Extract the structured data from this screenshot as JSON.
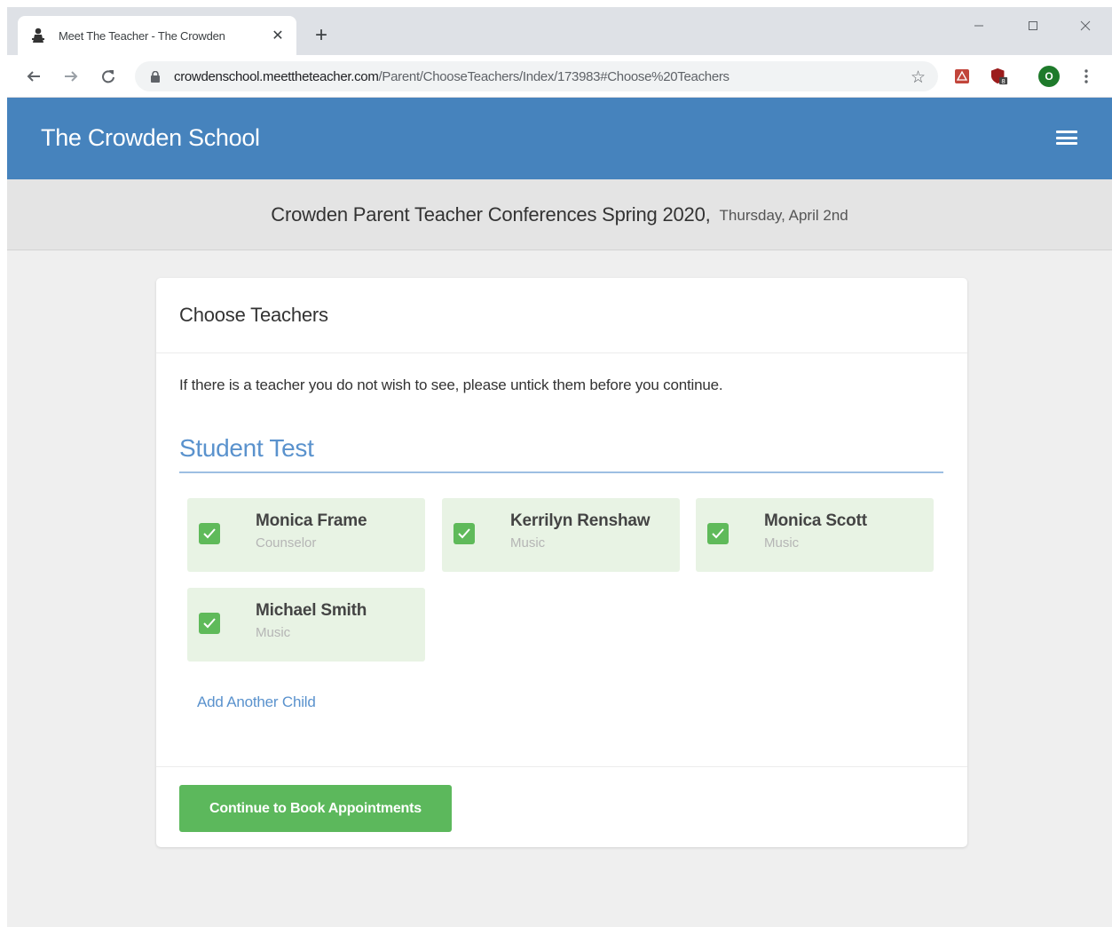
{
  "browser": {
    "tab_title": "Meet The Teacher - The Crowden",
    "tab_close": "✕",
    "new_tab": "+",
    "url_host": "crowdenschool.meettheteacher.com",
    "url_path": "/Parent/ChooseTeachers/Index/173983#Choose%20Teachers",
    "profile_initial": "O"
  },
  "header": {
    "brand": "The Crowden School",
    "menu_icon": "hamburger-menu-icon"
  },
  "event": {
    "name": "Crowden Parent Teacher Conferences Spring 2020,",
    "date": "Thursday, April 2nd"
  },
  "card": {
    "title": "Choose Teachers",
    "instructions": "If there is a teacher you do not wish to see, please untick them before you continue.",
    "student": "Student Test",
    "teachers": [
      {
        "name": "Monica Frame",
        "subject": "Counselor",
        "checked": true
      },
      {
        "name": "Kerrilyn Renshaw",
        "subject": "Music",
        "checked": true
      },
      {
        "name": "Monica Scott",
        "subject": "Music",
        "checked": true
      },
      {
        "name": "Michael Smith",
        "subject": "Music",
        "checked": true
      }
    ],
    "add_child": "Add Another Child",
    "continue": "Continue to Book Appointments"
  },
  "colors": {
    "header_bg": "#4683bd",
    "link": "#5a92cd",
    "teacher_bg": "#e8f3e4",
    "checkbox": "#5fba5a",
    "button": "#5cb85c"
  }
}
